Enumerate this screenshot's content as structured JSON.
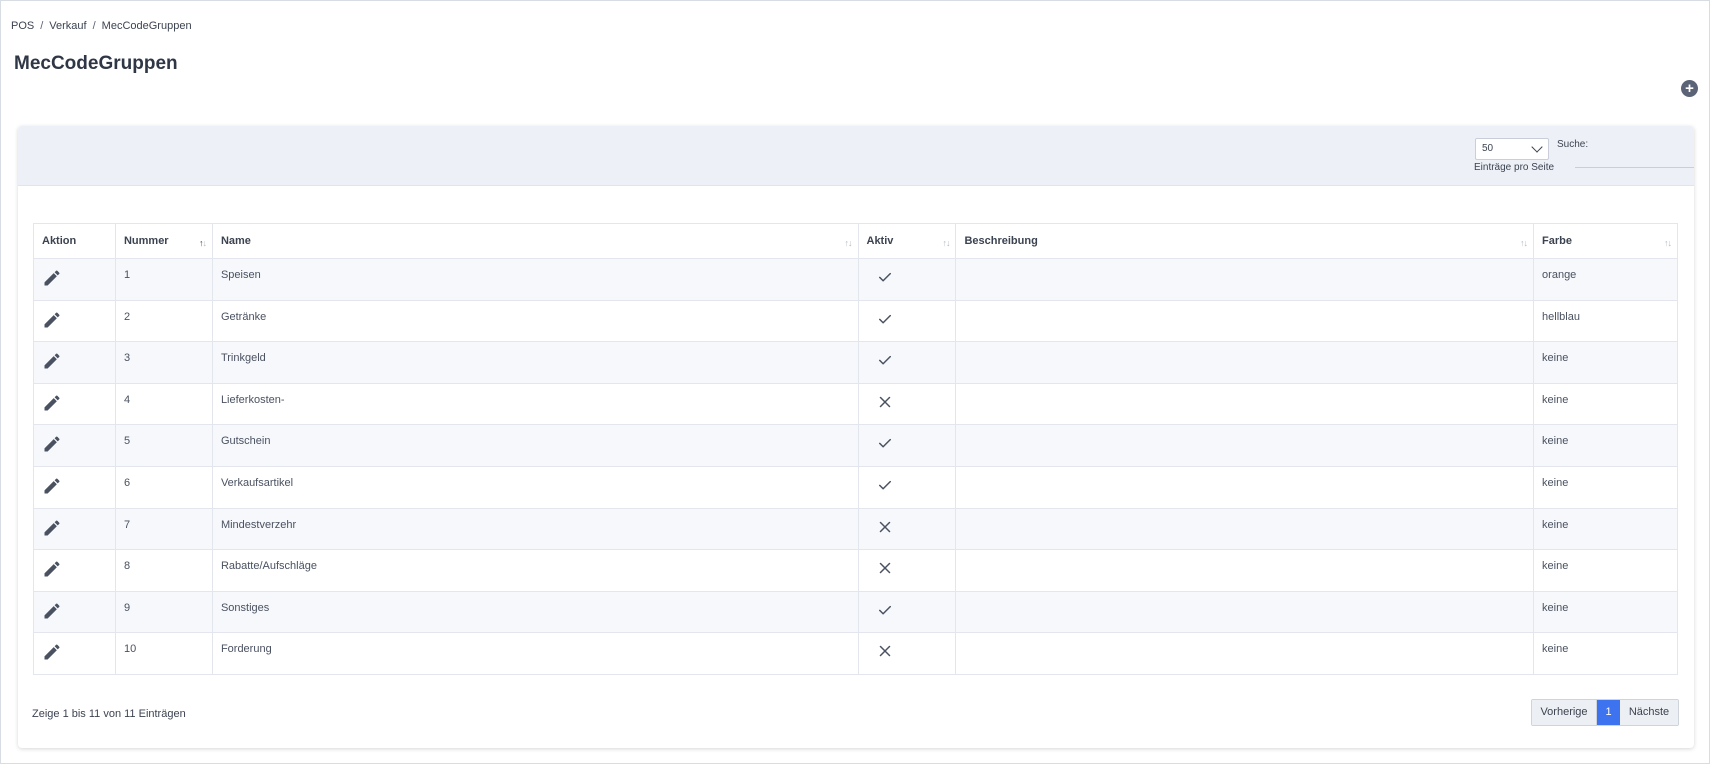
{
  "breadcrumb": {
    "items": [
      "POS",
      "Verkauf",
      "MecCodeGruppen"
    ],
    "separator": "/"
  },
  "page": {
    "title": "MecCodeGruppen"
  },
  "toolbar": {
    "add_symbol": "+"
  },
  "controls": {
    "page_length": "50",
    "page_length_label": "Einträge pro Seite",
    "search_label": "Suche:",
    "search_value": ""
  },
  "table": {
    "columns": [
      "Aktion",
      "Nummer",
      "Name",
      "Aktiv",
      "Beschreibung",
      "Farbe"
    ],
    "rows": [
      {
        "nummer": "1",
        "name": "Speisen",
        "aktiv": true,
        "beschreibung": "",
        "farbe": "orange"
      },
      {
        "nummer": "2",
        "name": "Getränke",
        "aktiv": true,
        "beschreibung": "",
        "farbe": "hellblau"
      },
      {
        "nummer": "3",
        "name": "Trinkgeld",
        "aktiv": true,
        "beschreibung": "",
        "farbe": "keine"
      },
      {
        "nummer": "4",
        "name": "Lieferkosten-",
        "aktiv": false,
        "beschreibung": "",
        "farbe": "keine"
      },
      {
        "nummer": "5",
        "name": "Gutschein",
        "aktiv": true,
        "beschreibung": "",
        "farbe": "keine"
      },
      {
        "nummer": "6",
        "name": "Verkaufsartikel",
        "aktiv": true,
        "beschreibung": "",
        "farbe": "keine"
      },
      {
        "nummer": "7",
        "name": "Mindestverzehr",
        "aktiv": false,
        "beschreibung": "",
        "farbe": "keine"
      },
      {
        "nummer": "8",
        "name": "Rabatte/Aufschläge",
        "aktiv": false,
        "beschreibung": "",
        "farbe": "keine"
      },
      {
        "nummer": "9",
        "name": "Sonstiges",
        "aktiv": true,
        "beschreibung": "",
        "farbe": "keine"
      },
      {
        "nummer": "10",
        "name": "Forderung",
        "aktiv": false,
        "beschreibung": "",
        "farbe": "keine"
      }
    ]
  },
  "footer": {
    "info": "Zeige 1 bis 11 von 11 Einträgen",
    "prev": "Vorherige",
    "current_page": "1",
    "next": "Nächste"
  },
  "colors": {
    "accent": "#3e73f0",
    "header_bg": "#edf1f7",
    "icon": "#4a5160"
  },
  "icons": {
    "edit": "pencil-icon",
    "active": "check-icon",
    "inactive": "cross-icon",
    "add": "plus-circle-icon"
  }
}
